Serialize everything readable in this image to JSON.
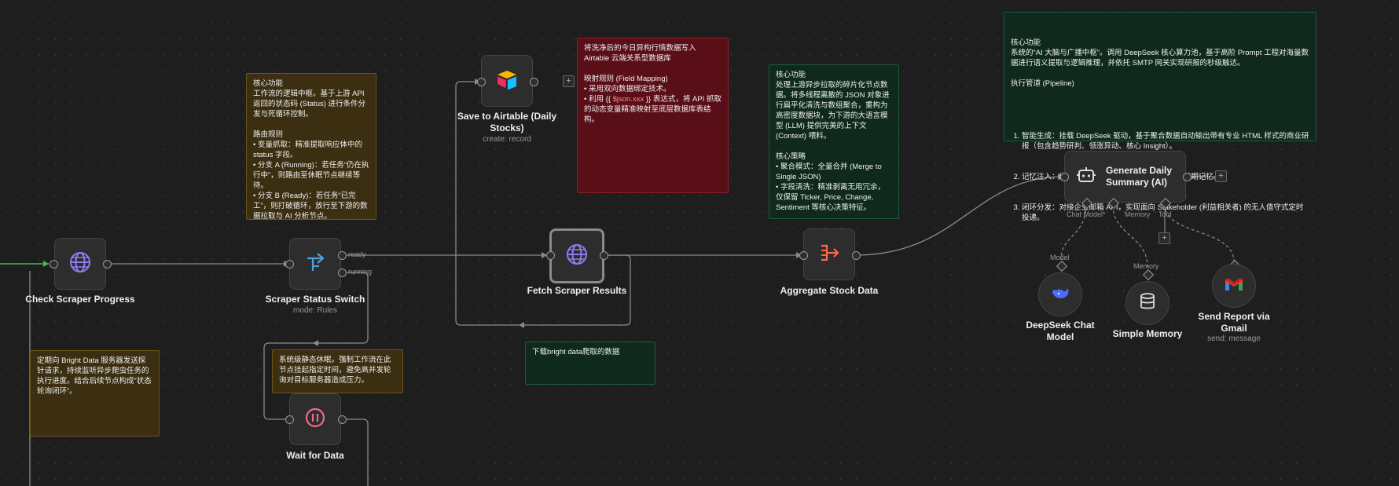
{
  "nodes": {
    "check_scraper": {
      "title": "Check Scraper Progress"
    },
    "status_switch": {
      "title": "Scraper Status Switch",
      "subtitle": "mode: Rules",
      "out_ready": "ready",
      "out_running": "running"
    },
    "wait": {
      "title": "Wait for Data"
    },
    "save_airtable": {
      "title": "Save to Airtable (Daily Stocks)",
      "subtitle": "create: record"
    },
    "fetch_results": {
      "title": "Fetch Scraper Results"
    },
    "aggregate": {
      "title": "Aggregate Stock Data"
    },
    "agent": {
      "title": "Generate Daily Summary (AI)",
      "chat_model_label": "Chat Model",
      "required_mark": "*",
      "memory_label": "Memory",
      "tool_label": "Tool"
    },
    "deepseek": {
      "title": "DeepSeek Chat Model",
      "in_label": "Model"
    },
    "memory": {
      "title": "Simple Memory",
      "in_label": "Memory"
    },
    "gmail": {
      "title": "Send Report via Gmail",
      "subtitle": "send: message"
    }
  },
  "notes": {
    "switch_note": "核心功能\n工作流的逻辑中枢。基于上游 API 返回的状态码 (Status) 进行条件分发与死循环控制。\n\n路由规则\n• 变量抓取：精准提取响应体中的 status 字段。\n• 分支 A (Running)：若任务“仍在执行中”，则路由至休眠节点继续等待。\n• 分支 B (Ready)：若任务“已完工”，则打破循环，放行至下游的数据拉取与 AI 分析节点。",
    "check_note": "定期向 Bright Data 服务器发送探针请求，持续监听异步爬虫任务的执行进度。结合后续节点构成“状态轮询闭环”。",
    "wait_note": "系统级静态休眠。强制工作流在此节点挂起指定时间，避免高并发轮询对目标服务器造成压力。",
    "airtable_note_1": "将洗净后的今日异构行情数据写入 Airtable 云端关系型数据库\n\n映射规则 (Field Mapping)\n• 采用双向数据绑定技术。\n• 利用 {{ ",
    "airtable_note_code": "$json.xxx",
    "airtable_note_2": " }} 表达式，将 API 抓取的动态变量精准映射至底层数据库表结构。",
    "fetch_note": "下载bright data爬取的数据",
    "aggregate_note": "核心功能\n处理上游异步拉取的碎片化节点数据。将多线程离散的 JSON 对象进行扁平化清洗与数组聚合，重构为高密度数据块，为下游的大语言模型 (LLM) 提供完美的上下文 (Context) 喂料。\n\n核心策略\n• 聚合模式：全量合并 (Merge to Single JSON)\n• 字段清洗：精准剥离无用冗余，仅保留 Ticker, Price, Change, Sentiment 等核心决策特征。",
    "agent_note_head": "核心功能\n系统的“AI 大脑与广播中枢”。调用 DeepSeek 核心算力池，基于高阶 Prompt 工程对海量数据进行语义提取与逻辑推理，并依托 SMTP 网关实现研报的秒级触达。\n\n执行管道 (Pipeline)",
    "agent_note_items": [
      "智能生成：挂载 DeepSeek 驱动，基于聚合数据自动输出带有专业 HTML 样式的商业研报（包含趋势研判、领涨异动、核心 Insight）。",
      "记忆注入：结合 Simple Memory 模块维持 Agent 长期记忆。",
      "闭环分发：对接企业邮箱 API，实现面向 Stakeholder (利益相关者) 的无人值守式定时投递。"
    ]
  },
  "plus_symbol": "+",
  "colors": {
    "edge": "#8a8a8a",
    "green_edge": "#3fb950",
    "globe": "#8c7cf0",
    "switch": "#4aa3df",
    "wait": "#f06b8a",
    "aggregate": "#ff6a4d"
  }
}
